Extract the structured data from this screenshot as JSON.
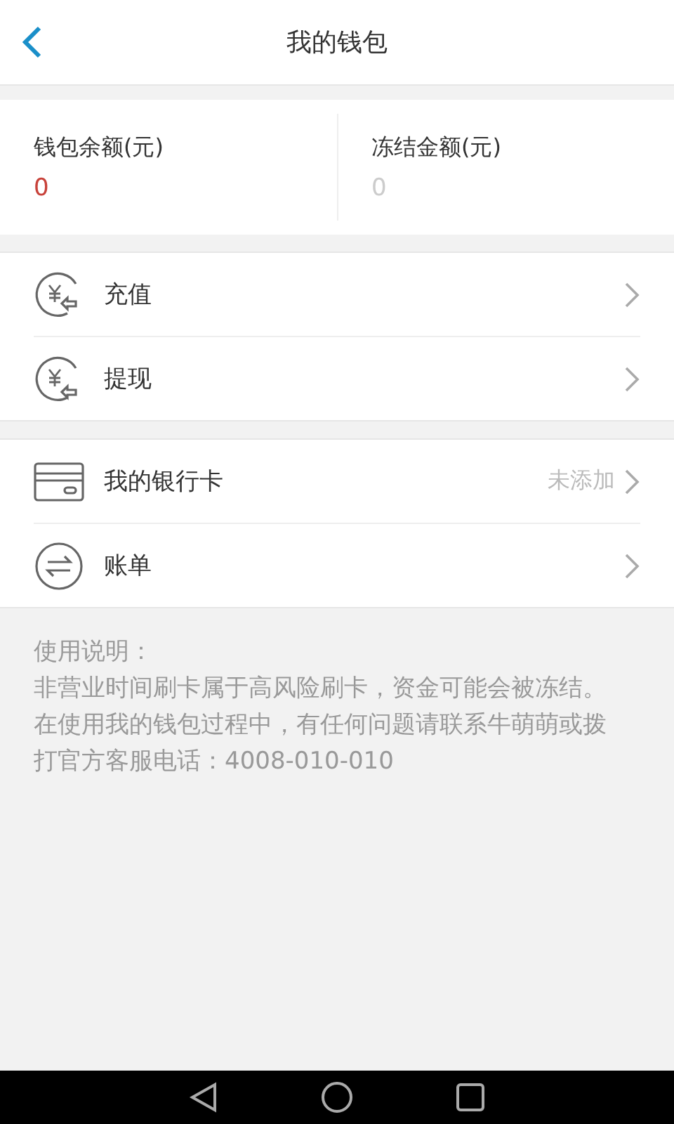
{
  "header": {
    "title": "我的钱包"
  },
  "balances": [
    {
      "label": "钱包余额(元)",
      "value": "0",
      "kind": "available"
    },
    {
      "label": "冻结金额(元)",
      "value": "0",
      "kind": "frozen"
    }
  ],
  "groups": [
    [
      {
        "kind": "recharge",
        "label": "充值"
      },
      {
        "kind": "withdraw",
        "label": "提现"
      }
    ],
    [
      {
        "kind": "card",
        "label": "我的银行卡",
        "status": "未添加"
      },
      {
        "kind": "bill",
        "label": "账单"
      }
    ]
  ],
  "notes": {
    "title": "使用说明：",
    "paragraphs": [
      "非营业时间刷卡属于高风险刷卡，资金可能会被冻结。",
      "在使用我的钱包过程中，有任何问题请联系牛萌萌或拨打官方客服电话：4008-010-010"
    ]
  }
}
